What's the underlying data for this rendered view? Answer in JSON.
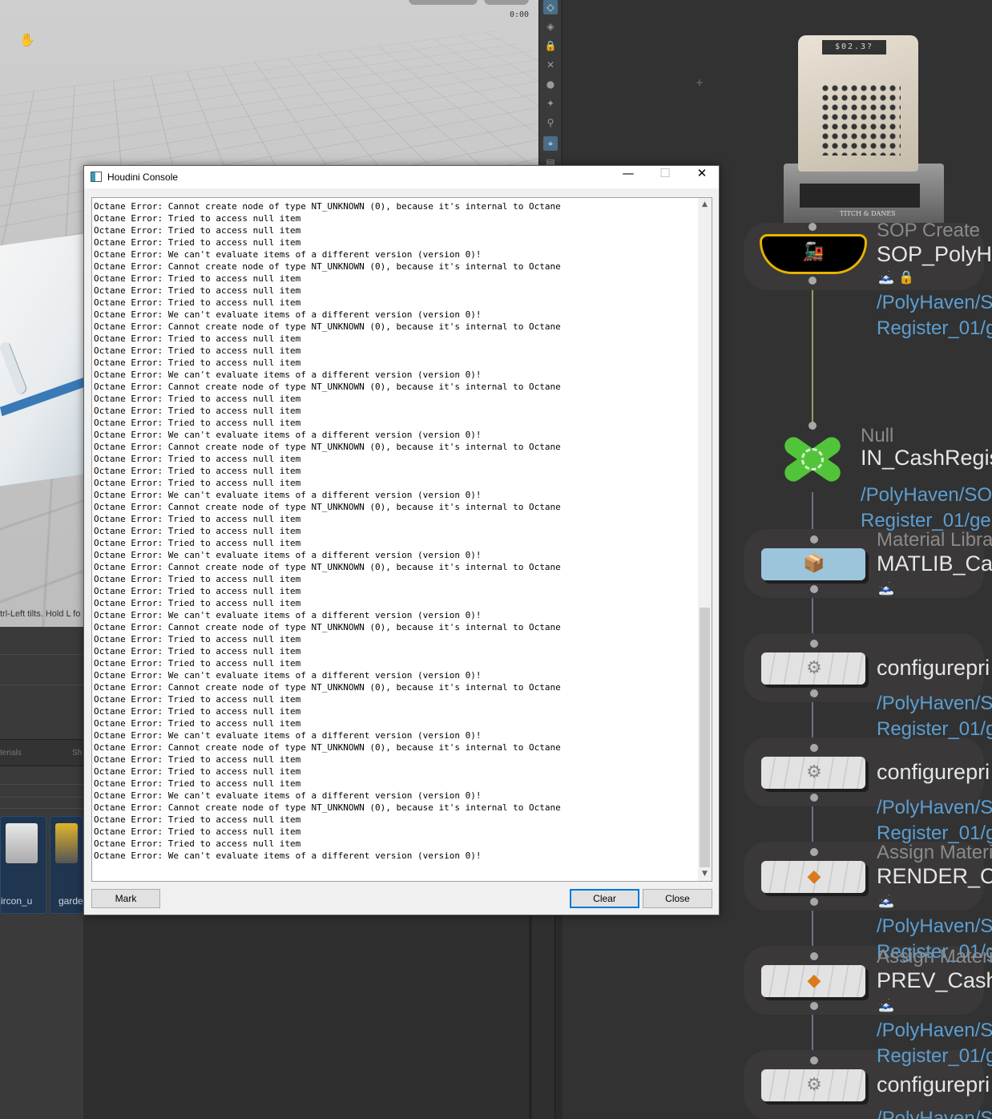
{
  "viewport": {
    "hint_text": "trl-Left tilts. Hold L fo",
    "timecode": "0:00",
    "hand_icon": "hand-pan-icon"
  },
  "lower_panel": {
    "tabs": [
      "terials",
      "Sh"
    ],
    "thumbnails": [
      {
        "label": "ircon_u",
        "icon": "air-conditioner-thumbnail"
      },
      {
        "label": "garde",
        "icon": "garden-tool-thumbnail"
      }
    ]
  },
  "console": {
    "title": "Houdini Console",
    "icon": "houdini-console-icon",
    "window_buttons": {
      "minimize": "—",
      "maximize": "☐",
      "close": "✕"
    },
    "log_lines": [
      "Octane Error: Cannot create node of type NT_UNKNOWN (0), because it's internal to Octane",
      "Octane Error: Tried to access null item",
      "Octane Error: Tried to access null item",
      "Octane Error: Tried to access null item",
      "Octane Error: We can't evaluate items of a different version (version 0)!",
      "Octane Error: Cannot create node of type NT_UNKNOWN (0), because it's internal to Octane",
      "Octane Error: Tried to access null item",
      "Octane Error: Tried to access null item",
      "Octane Error: Tried to access null item",
      "Octane Error: We can't evaluate items of a different version (version 0)!",
      "Octane Error: Cannot create node of type NT_UNKNOWN (0), because it's internal to Octane",
      "Octane Error: Tried to access null item",
      "Octane Error: Tried to access null item",
      "Octane Error: Tried to access null item",
      "Octane Error: We can't evaluate items of a different version (version 0)!",
      "Octane Error: Cannot create node of type NT_UNKNOWN (0), because it's internal to Octane",
      "Octane Error: Tried to access null item",
      "Octane Error: Tried to access null item",
      "Octane Error: Tried to access null item",
      "Octane Error: We can't evaluate items of a different version (version 0)!",
      "Octane Error: Cannot create node of type NT_UNKNOWN (0), because it's internal to Octane",
      "Octane Error: Tried to access null item",
      "Octane Error: Tried to access null item",
      "Octane Error: Tried to access null item",
      "Octane Error: We can't evaluate items of a different version (version 0)!",
      "Octane Error: Cannot create node of type NT_UNKNOWN (0), because it's internal to Octane",
      "Octane Error: Tried to access null item",
      "Octane Error: Tried to access null item",
      "Octane Error: Tried to access null item",
      "Octane Error: We can't evaluate items of a different version (version 0)!",
      "Octane Error: Cannot create node of type NT_UNKNOWN (0), because it's internal to Octane",
      "Octane Error: Tried to access null item",
      "Octane Error: Tried to access null item",
      "Octane Error: Tried to access null item",
      "Octane Error: We can't evaluate items of a different version (version 0)!",
      "Octane Error: Cannot create node of type NT_UNKNOWN (0), because it's internal to Octane",
      "Octane Error: Tried to access null item",
      "Octane Error: Tried to access null item",
      "Octane Error: Tried to access null item",
      "Octane Error: We can't evaluate items of a different version (version 0)!",
      "Octane Error: Cannot create node of type NT_UNKNOWN (0), because it's internal to Octane",
      "Octane Error: Tried to access null item",
      "Octane Error: Tried to access null item",
      "Octane Error: Tried to access null item",
      "Octane Error: We can't evaluate items of a different version (version 0)!",
      "Octane Error: Cannot create node of type NT_UNKNOWN (0), because it's internal to Octane",
      "Octane Error: Tried to access null item",
      "Octane Error: Tried to access null item",
      "Octane Error: Tried to access null item",
      "Octane Error: We can't evaluate items of a different version (version 0)!",
      "Octane Error: Cannot create node of type NT_UNKNOWN (0), because it's internal to Octane",
      "Octane Error: Tried to access null item",
      "Octane Error: Tried to access null item",
      "Octane Error: Tried to access null item",
      "Octane Error: We can't evaluate items of a different version (version 0)!"
    ],
    "buttons": {
      "mark": "Mark",
      "clear": "Clear",
      "close": "Close"
    }
  },
  "network": {
    "cash_register_counter": "$02.3?",
    "cash_register_plate": "TITCH & DANES",
    "nodes": [
      {
        "type": "SOP Create",
        "name": "SOP_PolyHa",
        "path": [
          "/PolyHaven/S",
          "Register_01/g"
        ],
        "icon": "train-icon",
        "flags": "🗻 🔒"
      },
      {
        "type": "Null",
        "name": "IN_CashRegis",
        "path": [
          "/PolyHaven/SO",
          "Register_01/ge"
        ],
        "icon": "null-x-icon"
      },
      {
        "type": "Material Libra",
        "name": "MATLIB_Cas",
        "path": [],
        "icon": "material-library-icon",
        "flags": "🗻"
      },
      {
        "type": "",
        "name": "configurepri",
        "path": [
          "/PolyHaven/S",
          "Register_01/g"
        ],
        "icon": "configure-primitive-icon"
      },
      {
        "type": "",
        "name": "configurepri",
        "path": [
          "/PolyHaven/S",
          "Register_01/g"
        ],
        "icon": "configure-primitive-icon"
      },
      {
        "type": "Assign Materi",
        "name": "RENDER_Ca",
        "path": [
          "/PolyHaven/S",
          "Register_01/g"
        ],
        "icon": "assign-material-icon",
        "flags": "🗻"
      },
      {
        "type": "Assign Materi",
        "name": "PREV_CashF",
        "path": [
          "/PolyHaven/S",
          "Register_01/g"
        ],
        "icon": "assign-material-icon",
        "flags": "🗻"
      },
      {
        "type": "",
        "name": "configurepri",
        "path": [
          "/PolyHaven/S"
        ],
        "icon": "configure-primitive-icon"
      }
    ]
  }
}
